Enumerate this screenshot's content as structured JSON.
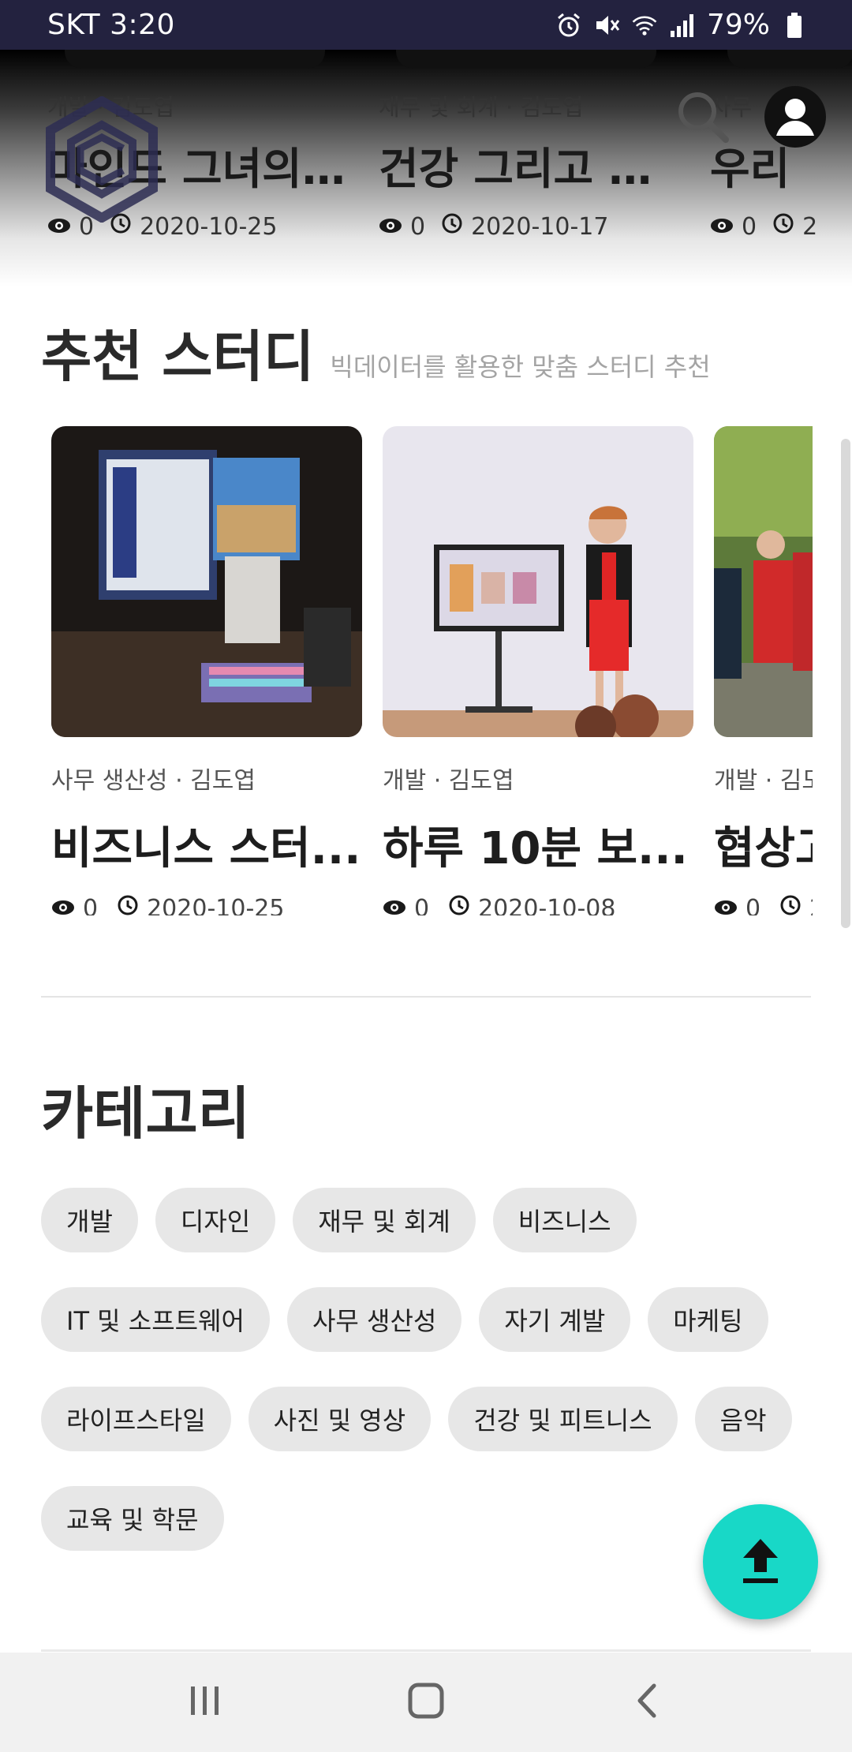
{
  "status_bar": {
    "carrier_time": "SKT 3:20",
    "battery": "79%",
    "icons": [
      "alarm-icon",
      "mute-icon",
      "wifi-icon",
      "signal-icon",
      "battery-icon"
    ]
  },
  "header": {
    "logo": "app-logo",
    "search_icon": "search-icon",
    "profile_icon": "profile-icon"
  },
  "top_cards": [
    {
      "meta": "개발 · 김도엽",
      "title": "마인드 그녀의 ...",
      "views": "0",
      "date": "2020-10-25"
    },
    {
      "meta": "재무 및 회계 · 김도엽",
      "title": "건강 그리고 맛...",
      "views": "0",
      "date": "2020-10-17"
    },
    {
      "meta": "사무",
      "title": "우리",
      "views": "0",
      "date": "2"
    }
  ],
  "recommended": {
    "title": "추천 스터디",
    "subtitle": "빅데이터를 활용한 맞춤 스터디 추천",
    "cards": [
      {
        "meta": "사무 생산성 · 김도엽",
        "title": "비즈니스 스터...",
        "views": "0",
        "date": "2020-10-25"
      },
      {
        "meta": "개발 · 김도엽",
        "title": "하루 10분 보...",
        "views": "0",
        "date": "2020-10-08"
      },
      {
        "meta": "개발 · 김도엽",
        "title": "협상고",
        "views": "0",
        "date": "2"
      }
    ]
  },
  "categories": {
    "title": "카테고리",
    "items": [
      "개발",
      "디자인",
      "재무 및 회계",
      "비즈니스",
      "IT 및 소프트웨어",
      "사무 생산성",
      "자기 계발",
      "마케팅",
      "라이프스타일",
      "사진 및 영상",
      "건강 및 피트니스",
      "음악",
      "교육 및 학문"
    ]
  },
  "fab": {
    "icon": "upload-arrow-icon",
    "color": "#18d8c7"
  },
  "nav_bar": {
    "icons": [
      "recent-apps-icon",
      "home-icon",
      "back-icon"
    ]
  },
  "colors": {
    "status_bar": "#23223f",
    "accent": "#18d8c7",
    "chip_bg": "#e7e7e7"
  }
}
